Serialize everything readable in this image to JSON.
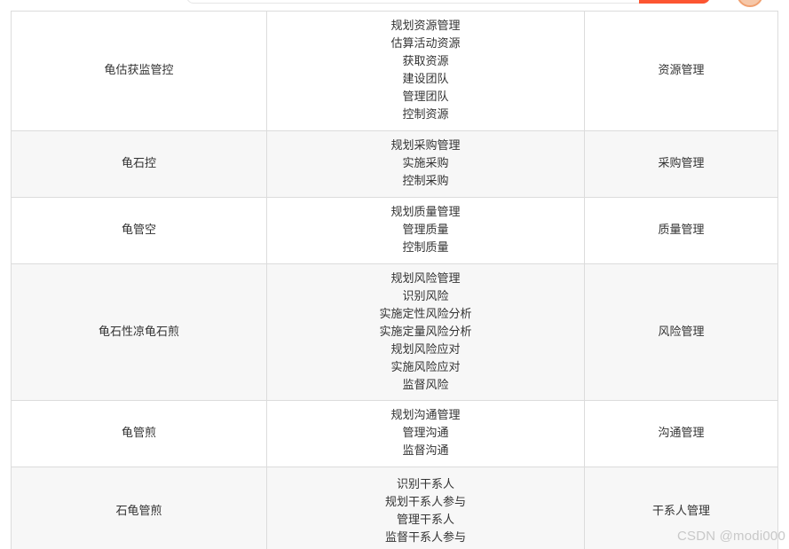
{
  "rows": [
    {
      "mnemonic": "龟估获监管控",
      "processes": [
        "规划资源管理",
        "估算活动资源",
        "获取资源",
        "建设团队",
        "管理团队",
        "控制资源"
      ],
      "area": "资源管理"
    },
    {
      "mnemonic": "龟石控",
      "processes": [
        "规划采购管理",
        "实施采购",
        "控制采购"
      ],
      "area": "采购管理"
    },
    {
      "mnemonic": "龟管空",
      "processes": [
        "规划质量管理",
        "管理质量",
        "控制质量"
      ],
      "area": "质量管理"
    },
    {
      "mnemonic": "龟石性凉龟石煎",
      "processes": [
        "规划风险管理",
        "识别风险",
        "实施定性风险分析",
        "实施定量风险分析",
        "规划风险应对",
        "实施风险应对",
        "监督风险"
      ],
      "area": "风险管理"
    },
    {
      "mnemonic": "龟管煎",
      "processes": [
        "规划沟通管理",
        "管理沟通",
        "监督沟通"
      ],
      "area": "沟通管理"
    },
    {
      "mnemonic": "石龟管煎",
      "processes": [
        "识别干系人",
        "规划干系人参与",
        "管理干系人",
        "监督干系人参与"
      ],
      "area": "干系人管理"
    }
  ],
  "watermark": "CSDN @modi000",
  "colors": {
    "accent": "#fc5531",
    "border": "#dcdcdc",
    "shade": "#f7f7f7"
  }
}
